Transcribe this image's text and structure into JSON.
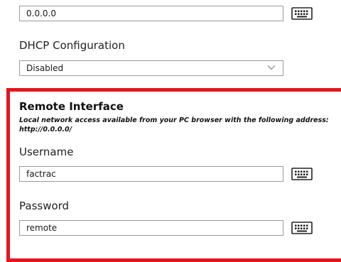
{
  "ip": {
    "value": "0.0.0.0"
  },
  "dhcp": {
    "label": "DHCP Configuration",
    "value": "Disabled"
  },
  "remote_interface": {
    "title": "Remote Interface",
    "description_line1": "Local network access available from your PC browser with the following address:",
    "description_line2": "http://0.0.0.0/",
    "username_label": "Username",
    "username_value": "factrac",
    "password_label": "Password",
    "password_value": "remote"
  },
  "icons": {
    "keyboard": "keyboard-icon",
    "dropdown": "chevron-down-icon"
  },
  "colors": {
    "highlight_frame": "#e2161c",
    "field_border": "#9a9a9a"
  }
}
